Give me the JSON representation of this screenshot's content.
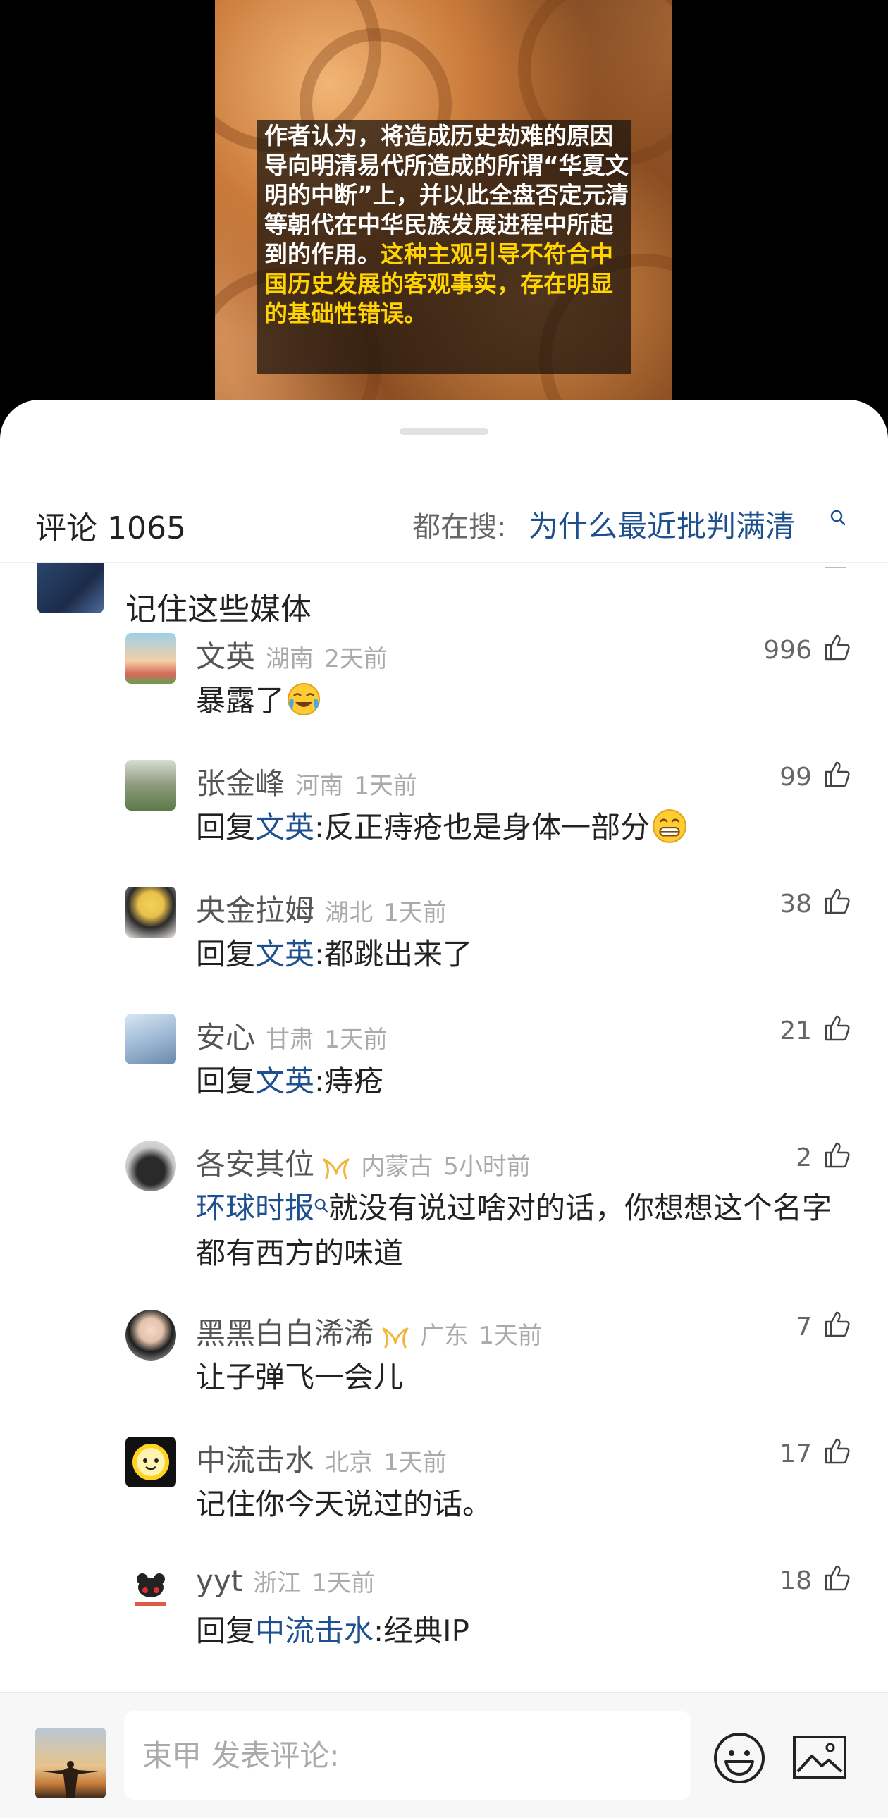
{
  "video": {
    "subtitle_white": "作者认为，将造成历史劫难的原因导向明清易代所造成的所谓“华夏文明的中断”上，并以此全盘否定元清等朝代在中华民族发展进程中所起到的作用。",
    "subtitle_yellow": "这种主观引导不符合中国历史发展的客观事实，存在明显的基础性错误。"
  },
  "header": {
    "comment_count_label": "评论 1065",
    "trending_label": "都在搜:",
    "trending_query": "为什么最近批判满清"
  },
  "parent_comment": {
    "text": "记住这些媒体"
  },
  "replies": [
    {
      "name": "文英",
      "location": "湖南",
      "time": "2天前",
      "likes": "996",
      "reply_prefix": "",
      "reply_to": "",
      "text": "暴露了",
      "emoji": "cry-laugh"
    },
    {
      "name": "张金峰",
      "location": "河南",
      "time": "1天前",
      "likes": "99",
      "reply_prefix": "回复",
      "reply_to": "文英",
      "text": ":反正痔疮也是身体一部分",
      "emoji": "grin"
    },
    {
      "name": "央金拉姆",
      "location": "湖北",
      "time": "1天前",
      "likes": "38",
      "reply_prefix": "回复",
      "reply_to": "文英",
      "text": ":都跳出来了"
    },
    {
      "name": "安心",
      "location": "甘肃",
      "time": "1天前",
      "likes": "21",
      "reply_prefix": "回复",
      "reply_to": "文英",
      "text": ":痔疮"
    },
    {
      "name": "各安其位",
      "location": "内蒙古",
      "time": "5小时前",
      "likes": "2",
      "link": "环球时报",
      "text": "就没有说过啥对的话，你想想这个名字都有西方的味道",
      "badge": "vip-badge"
    },
    {
      "name": "黑黑白白浠浠",
      "location": "广东",
      "time": "1天前",
      "likes": "7",
      "text": "让子弹飞一会儿",
      "badge": "vip-badge"
    },
    {
      "name": "中流击水",
      "location": "北京",
      "time": "1天前",
      "likes": "17",
      "text": "记住你今天说过的话。"
    },
    {
      "name": "yyt",
      "location": "浙江",
      "time": "1天前",
      "likes": "18",
      "reply_prefix": "回复",
      "reply_to": "中流击水",
      "text": ":经典IP"
    }
  ],
  "input_bar": {
    "placeholder": "束甲 发表评论:"
  },
  "colors": {
    "link": "#1e4f8f",
    "subtitle_highlight": "#ffd400",
    "badge": "#f0b53a"
  }
}
